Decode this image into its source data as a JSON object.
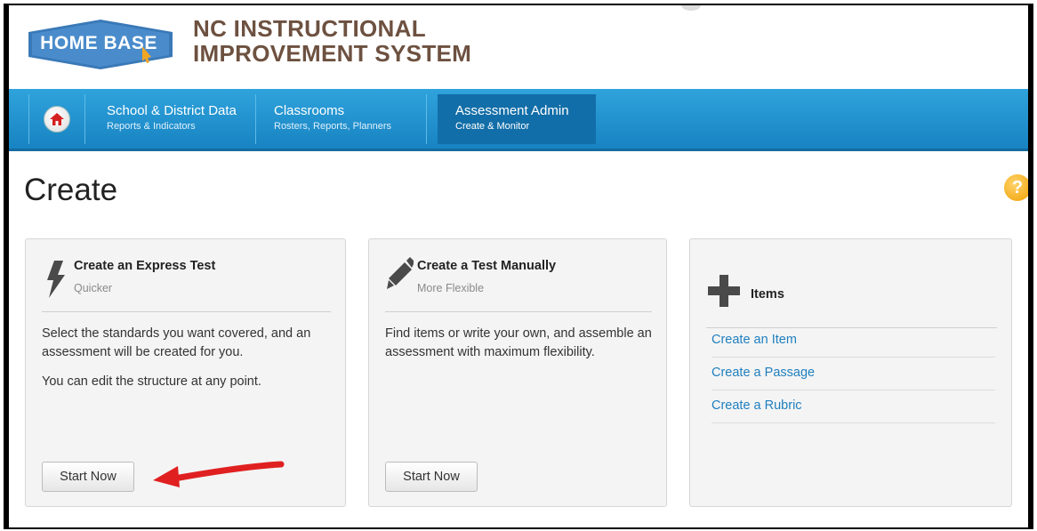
{
  "header": {
    "logo_text": "HOME BASE",
    "system_title_line1": "NC INSTRUCTIONAL",
    "system_title_line2": "IMPROVEMENT SYSTEM"
  },
  "nav": {
    "items": [
      {
        "title": "School & District Data",
        "subtitle": "Reports & Indicators"
      },
      {
        "title": "Classrooms",
        "subtitle": "Rosters, Reports, Planners"
      },
      {
        "title": "Assessment Admin",
        "subtitle": "Create & Monitor"
      }
    ]
  },
  "page": {
    "title": "Create",
    "help_label": "?"
  },
  "panels": {
    "express": {
      "title": "Create an Express Test",
      "subtitle": "Quicker",
      "body1": "Select the standards you want covered, and an assessment will be created for you.",
      "body2": "You can edit the structure at any point.",
      "button": "Start Now"
    },
    "manual": {
      "title": "Create a Test Manually",
      "subtitle": "More Flexible",
      "body1": "Find items or write your own, and assemble an assessment with maximum flexibility.",
      "button": "Start Now"
    },
    "items": {
      "title": "Items",
      "links": [
        "Create an Item",
        "Create a Passage",
        "Create a Rubric"
      ]
    }
  },
  "colors": {
    "nav_blue": "#1f95d2",
    "nav_active": "#126ea8",
    "title_brown": "#6d5140",
    "link_blue": "#1f7fbf",
    "arrow_red": "#e02020",
    "help_orange": "#f0a000"
  },
  "icons": {
    "home": "home-icon",
    "express": "lightning-icon",
    "manual": "pencil-icon",
    "items": "plus-icon",
    "help": "help-icon"
  }
}
